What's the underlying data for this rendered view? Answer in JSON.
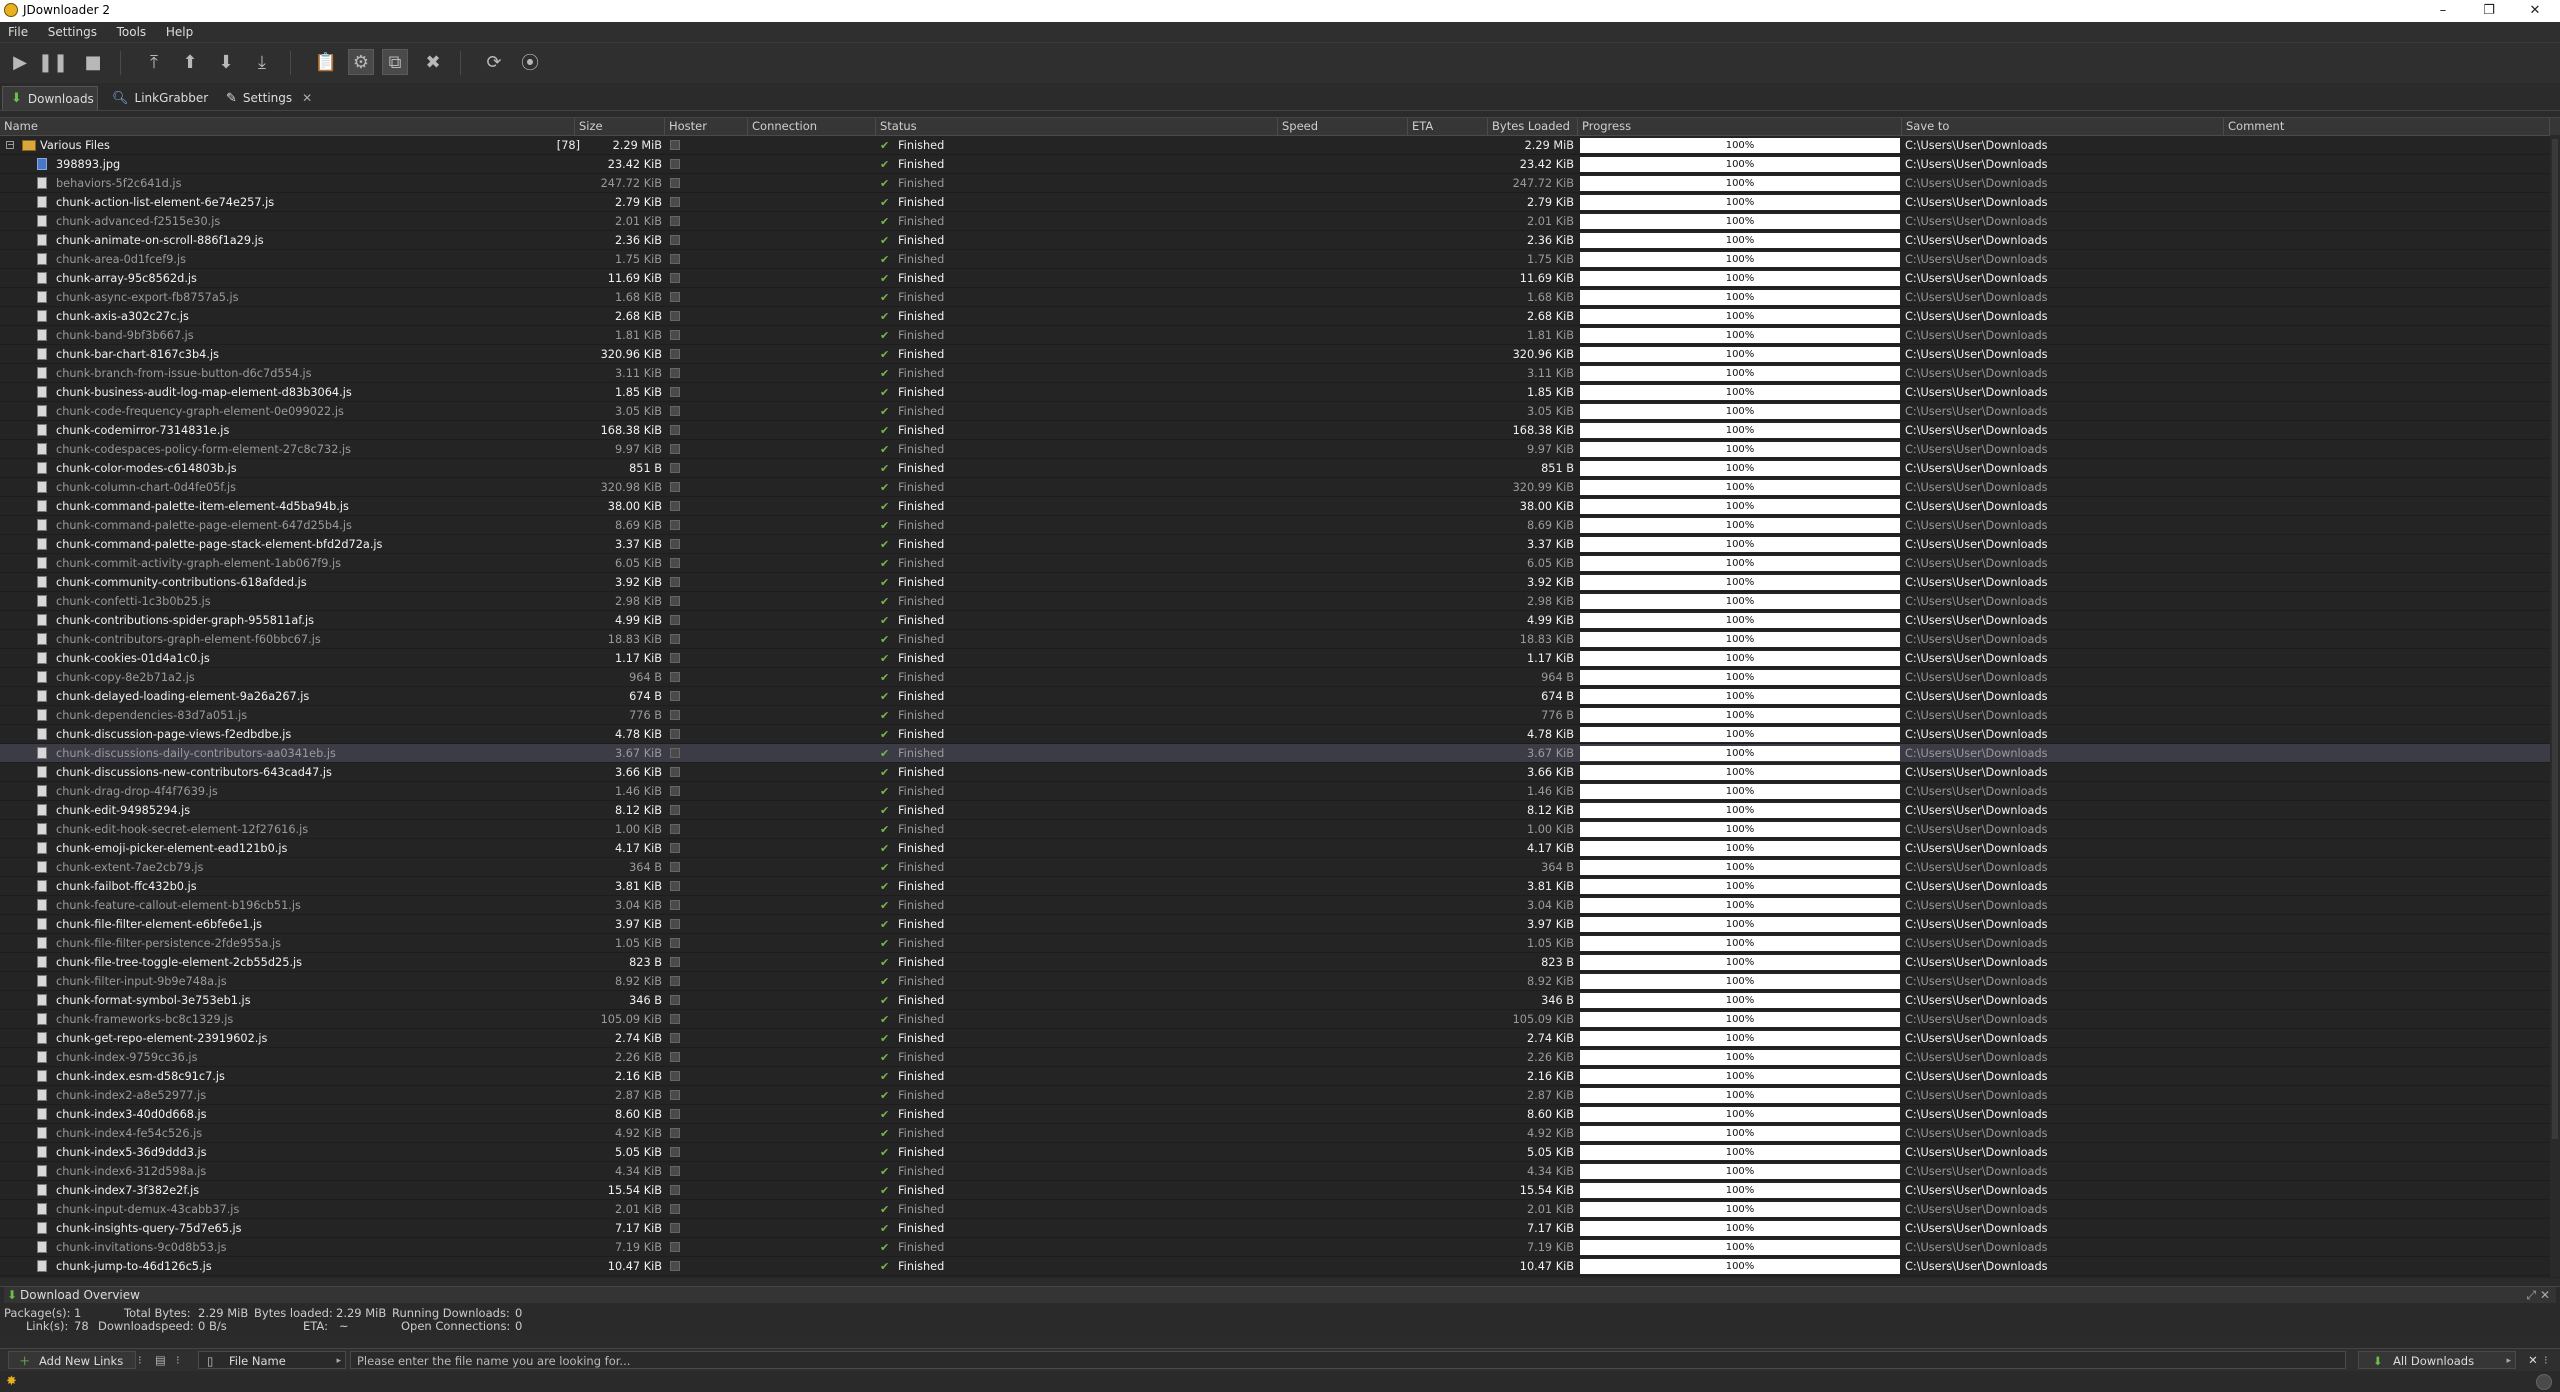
{
  "window": {
    "title": "JDownloader 2",
    "minimize": "–",
    "maximize": "❐",
    "close": "✕"
  },
  "menu": [
    "File",
    "Settings",
    "Tools",
    "Help"
  ],
  "tabs": [
    {
      "label": "Downloads",
      "icon": "download-arrow-icon"
    },
    {
      "label": "LinkGrabber",
      "icon": "magnifier-icon"
    },
    {
      "label": "Settings",
      "icon": "wrench-icon",
      "close": "✕"
    }
  ],
  "columns": [
    "Name",
    "Size",
    "Hoster",
    "Connection",
    "Status",
    "Speed",
    "ETA",
    "Bytes Loaded",
    "Progress",
    "Save to",
    "Comment"
  ],
  "package": {
    "name": "Various Files",
    "count": "[78]",
    "size": "2.29 MiB",
    "status": "Finished",
    "bytes": "2.29 MiB",
    "progress": "100%",
    "save_to": "C:\\Users\\User\\Downloads"
  },
  "files": [
    {
      "name": "398893.jpg",
      "size": "23.42 KiB",
      "bytes": "23.42 KiB"
    },
    {
      "name": "behaviors-5f2c641d.js",
      "size": "247.72 KiB",
      "bytes": "247.72 KiB"
    },
    {
      "name": "chunk-action-list-element-6e74e257.js",
      "size": "2.79 KiB",
      "bytes": "2.79 KiB"
    },
    {
      "name": "chunk-advanced-f2515e30.js",
      "size": "2.01 KiB",
      "bytes": "2.01 KiB"
    },
    {
      "name": "chunk-animate-on-scroll-886f1a29.js",
      "size": "2.36 KiB",
      "bytes": "2.36 KiB"
    },
    {
      "name": "chunk-area-0d1fcef9.js",
      "size": "1.75 KiB",
      "bytes": "1.75 KiB"
    },
    {
      "name": "chunk-array-95c8562d.js",
      "size": "11.69 KiB",
      "bytes": "11.69 KiB"
    },
    {
      "name": "chunk-async-export-fb8757a5.js",
      "size": "1.68 KiB",
      "bytes": "1.68 KiB"
    },
    {
      "name": "chunk-axis-a302c27c.js",
      "size": "2.68 KiB",
      "bytes": "2.68 KiB"
    },
    {
      "name": "chunk-band-9bf3b667.js",
      "size": "1.81 KiB",
      "bytes": "1.81 KiB"
    },
    {
      "name": "chunk-bar-chart-8167c3b4.js",
      "size": "320.96 KiB",
      "bytes": "320.96 KiB"
    },
    {
      "name": "chunk-branch-from-issue-button-d6c7d554.js",
      "size": "3.11 KiB",
      "bytes": "3.11 KiB"
    },
    {
      "name": "chunk-business-audit-log-map-element-d83b3064.js",
      "size": "1.85 KiB",
      "bytes": "1.85 KiB"
    },
    {
      "name": "chunk-code-frequency-graph-element-0e099022.js",
      "size": "3.05 KiB",
      "bytes": "3.05 KiB"
    },
    {
      "name": "chunk-codemirror-7314831e.js",
      "size": "168.38 KiB",
      "bytes": "168.38 KiB"
    },
    {
      "name": "chunk-codespaces-policy-form-element-27c8c732.js",
      "size": "9.97 KiB",
      "bytes": "9.97 KiB"
    },
    {
      "name": "chunk-color-modes-c614803b.js",
      "size": "851 B",
      "bytes": "851 B"
    },
    {
      "name": "chunk-column-chart-0d4fe05f.js",
      "size": "320.98 KiB",
      "bytes": "320.99 KiB"
    },
    {
      "name": "chunk-command-palette-item-element-4d5ba94b.js",
      "size": "38.00 KiB",
      "bytes": "38.00 KiB"
    },
    {
      "name": "chunk-command-palette-page-element-647d25b4.js",
      "size": "8.69 KiB",
      "bytes": "8.69 KiB"
    },
    {
      "name": "chunk-command-palette-page-stack-element-bfd2d72a.js",
      "size": "3.37 KiB",
      "bytes": "3.37 KiB"
    },
    {
      "name": "chunk-commit-activity-graph-element-1ab067f9.js",
      "size": "6.05 KiB",
      "bytes": "6.05 KiB"
    },
    {
      "name": "chunk-community-contributions-618afded.js",
      "size": "3.92 KiB",
      "bytes": "3.92 KiB"
    },
    {
      "name": "chunk-confetti-1c3b0b25.js",
      "size": "2.98 KiB",
      "bytes": "2.98 KiB"
    },
    {
      "name": "chunk-contributions-spider-graph-955811af.js",
      "size": "4.99 KiB",
      "bytes": "4.99 KiB"
    },
    {
      "name": "chunk-contributors-graph-element-f60bbc67.js",
      "size": "18.83 KiB",
      "bytes": "18.83 KiB"
    },
    {
      "name": "chunk-cookies-01d4a1c0.js",
      "size": "1.17 KiB",
      "bytes": "1.17 KiB"
    },
    {
      "name": "chunk-copy-8e2b71a2.js",
      "size": "964 B",
      "bytes": "964 B"
    },
    {
      "name": "chunk-delayed-loading-element-9a26a267.js",
      "size": "674 B",
      "bytes": "674 B"
    },
    {
      "name": "chunk-dependencies-83d7a051.js",
      "size": "776 B",
      "bytes": "776 B"
    },
    {
      "name": "chunk-discussion-page-views-f2edbdbe.js",
      "size": "4.78 KiB",
      "bytes": "4.78 KiB"
    },
    {
      "name": "chunk-discussions-daily-contributors-aa0341eb.js",
      "size": "3.67 KiB",
      "bytes": "3.67 KiB"
    },
    {
      "name": "chunk-discussions-new-contributors-643cad47.js",
      "size": "3.66 KiB",
      "bytes": "3.66 KiB"
    },
    {
      "name": "chunk-drag-drop-4f4f7639.js",
      "size": "1.46 KiB",
      "bytes": "1.46 KiB"
    },
    {
      "name": "chunk-edit-94985294.js",
      "size": "8.12 KiB",
      "bytes": "8.12 KiB"
    },
    {
      "name": "chunk-edit-hook-secret-element-12f27616.js",
      "size": "1.00 KiB",
      "bytes": "1.00 KiB"
    },
    {
      "name": "chunk-emoji-picker-element-ead121b0.js",
      "size": "4.17 KiB",
      "bytes": "4.17 KiB"
    },
    {
      "name": "chunk-extent-7ae2cb79.js",
      "size": "364 B",
      "bytes": "364 B"
    },
    {
      "name": "chunk-failbot-ffc432b0.js",
      "size": "3.81 KiB",
      "bytes": "3.81 KiB"
    },
    {
      "name": "chunk-feature-callout-element-b196cb51.js",
      "size": "3.04 KiB",
      "bytes": "3.04 KiB"
    },
    {
      "name": "chunk-file-filter-element-e6bfe6e1.js",
      "size": "3.97 KiB",
      "bytes": "3.97 KiB"
    },
    {
      "name": "chunk-file-filter-persistence-2fde955a.js",
      "size": "1.05 KiB",
      "bytes": "1.05 KiB"
    },
    {
      "name": "chunk-file-tree-toggle-element-2cb55d25.js",
      "size": "823 B",
      "bytes": "823 B"
    },
    {
      "name": "chunk-filter-input-9b9e748a.js",
      "size": "8.92 KiB",
      "bytes": "8.92 KiB"
    },
    {
      "name": "chunk-format-symbol-3e753eb1.js",
      "size": "346 B",
      "bytes": "346 B"
    },
    {
      "name": "chunk-frameworks-bc8c1329.js",
      "size": "105.09 KiB",
      "bytes": "105.09 KiB"
    },
    {
      "name": "chunk-get-repo-element-23919602.js",
      "size": "2.74 KiB",
      "bytes": "2.74 KiB"
    },
    {
      "name": "chunk-index-9759cc36.js",
      "size": "2.26 KiB",
      "bytes": "2.26 KiB"
    },
    {
      "name": "chunk-index.esm-d58c91c7.js",
      "size": "2.16 KiB",
      "bytes": "2.16 KiB"
    },
    {
      "name": "chunk-index2-a8e52977.js",
      "size": "2.87 KiB",
      "bytes": "2.87 KiB"
    },
    {
      "name": "chunk-index3-40d0d668.js",
      "size": "8.60 KiB",
      "bytes": "8.60 KiB"
    },
    {
      "name": "chunk-index4-fe54c526.js",
      "size": "4.92 KiB",
      "bytes": "4.92 KiB"
    },
    {
      "name": "chunk-index5-36d9ddd3.js",
      "size": "5.05 KiB",
      "bytes": "5.05 KiB"
    },
    {
      "name": "chunk-index6-312d598a.js",
      "size": "4.34 KiB",
      "bytes": "4.34 KiB"
    },
    {
      "name": "chunk-index7-3f382e2f.js",
      "size": "15.54 KiB",
      "bytes": "15.54 KiB"
    },
    {
      "name": "chunk-input-demux-43cabb37.js",
      "size": "2.01 KiB",
      "bytes": "2.01 KiB"
    },
    {
      "name": "chunk-insights-query-75d7e65.js",
      "size": "7.17 KiB",
      "bytes": "7.17 KiB"
    },
    {
      "name": "chunk-invitations-9c0d8b53.js",
      "size": "7.19 KiB",
      "bytes": "7.19 KiB"
    },
    {
      "name": "chunk-jump-to-46d126c5.js",
      "size": "10.47 KiB",
      "bytes": "10.47 KiB"
    }
  ],
  "row_defaults": {
    "status": "Finished",
    "progress": "100%",
    "save_to": "C:\\Users\\User\\Downloads"
  },
  "selected_row": "chunk-discussions-daily-contributors-aa0341eb.js",
  "overview": {
    "title": "Download Overview",
    "packages_label": "Package(s):",
    "packages_value": "1",
    "total_bytes_label": "Total Bytes:",
    "total_bytes_value": "2.29 MiB",
    "bytes_loaded_label": "Bytes loaded:",
    "bytes_loaded_value": "2.29 MiB",
    "running_label": "Running Downloads:",
    "running_value": "0",
    "links_label": "Link(s):",
    "links_value": "78",
    "speed_label": "Downloadspeed:",
    "speed_value": "0 B/s",
    "eta_label": "ETA:",
    "eta_value": "~",
    "open_conn_label": "Open Connections:",
    "open_conn_value": "0"
  },
  "bottombar": {
    "add_links": "Add New Links",
    "search_field_type": "File Name",
    "search_placeholder": "Please enter the file name you are looking for...",
    "view_select": "All Downloads"
  },
  "colors": {
    "accent_green": "#74b84a",
    "progress_fill": "#ffffff",
    "selection": "#3c3c46"
  }
}
